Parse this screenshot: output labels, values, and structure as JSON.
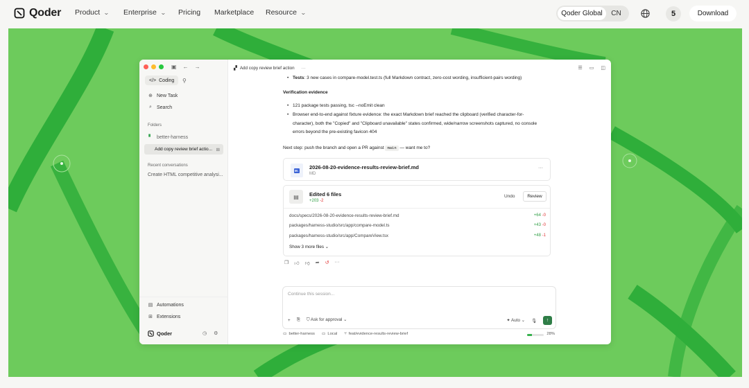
{
  "nav": {
    "brand": "Qoder",
    "items": [
      {
        "label": "Product",
        "dropdown": true
      },
      {
        "label": "Enterprise",
        "dropdown": true
      },
      {
        "label": "Pricing",
        "dropdown": false
      },
      {
        "label": "Marketplace",
        "dropdown": false
      },
      {
        "label": "Resource",
        "dropdown": true
      }
    ],
    "region_active": "Qoder Global",
    "region_other": "CN",
    "notification_count": "5",
    "download_label": "Download"
  },
  "colors": {
    "hero_green": "#6dcb5c",
    "stripe_green": "#2fae3a",
    "accent_green": "#2f7d47",
    "plus": "#2f9e44",
    "minus": "#e03131"
  },
  "app": {
    "sidebar": {
      "mode_label": "Coding",
      "new_task": "New Task",
      "search": "Search",
      "folders_heading": "Folders",
      "folder_name": "better-harness",
      "active_thread": "Add copy review brief actio...",
      "recent_heading": "Recent conversations",
      "recent_item": "Create HTML competitive analysi...",
      "automations": "Automations",
      "extensions": "Extensions",
      "brand": "Qoder"
    },
    "tab_title": "Add copy review brief action",
    "content": {
      "tests_label": "Tests",
      "tests_text": ": 3 new cases in compare-model.test.ts (full Markdown contract, zero-cost wording, insufficient-pairs wording)",
      "verification_heading": "Verification evidence",
      "bullet1": "121 package tests passing, tsc --noEmit clean",
      "bullet2_l1": "Browser end-to-end against fixture evidence: the exact Markdown brief reached the clipboard (verified character-for-",
      "bullet2_l2": "character), both the \"Copied\" and \"Clipboard unavailable\" states confirmed, wide/narrow screenshots captured, no console",
      "bullet2_l3": "errors beyond the pre-existing favicon 404",
      "next_step_a": "Next step: push the branch and open a PR against",
      "next_step_branch": "main",
      "next_step_b": "— want me to?"
    },
    "file_card": {
      "icon_text": "M↓",
      "name": "2026-08-20-evidence-results-review-brief.md",
      "type": "MD"
    },
    "edit_card": {
      "title": "Edited 6 files",
      "added": "+203",
      "removed": "-2",
      "undo": "Undo",
      "review": "Review",
      "files": [
        {
          "path": "docs/specs/2026-08-20-evidence-results-review-brief.md",
          "added": "+64",
          "removed": "-0"
        },
        {
          "path": "packages/harness-studio/src/app/compare-model.ts",
          "added": "+43",
          "removed": "-0"
        },
        {
          "path": "packages/harness-studio/src/app/CompareView.tsx",
          "added": "+48",
          "removed": "-1"
        }
      ],
      "show_more": "Show 3 more files"
    },
    "composer": {
      "placeholder": "Continue this session...",
      "approval": "Ask for approval",
      "model": "Auto"
    },
    "statusbar": {
      "folder": "better-harness",
      "env": "Local",
      "branch": "feat/evidence-results-review-brief",
      "context_pct": "28%",
      "context_fraction": 0.28
    }
  }
}
